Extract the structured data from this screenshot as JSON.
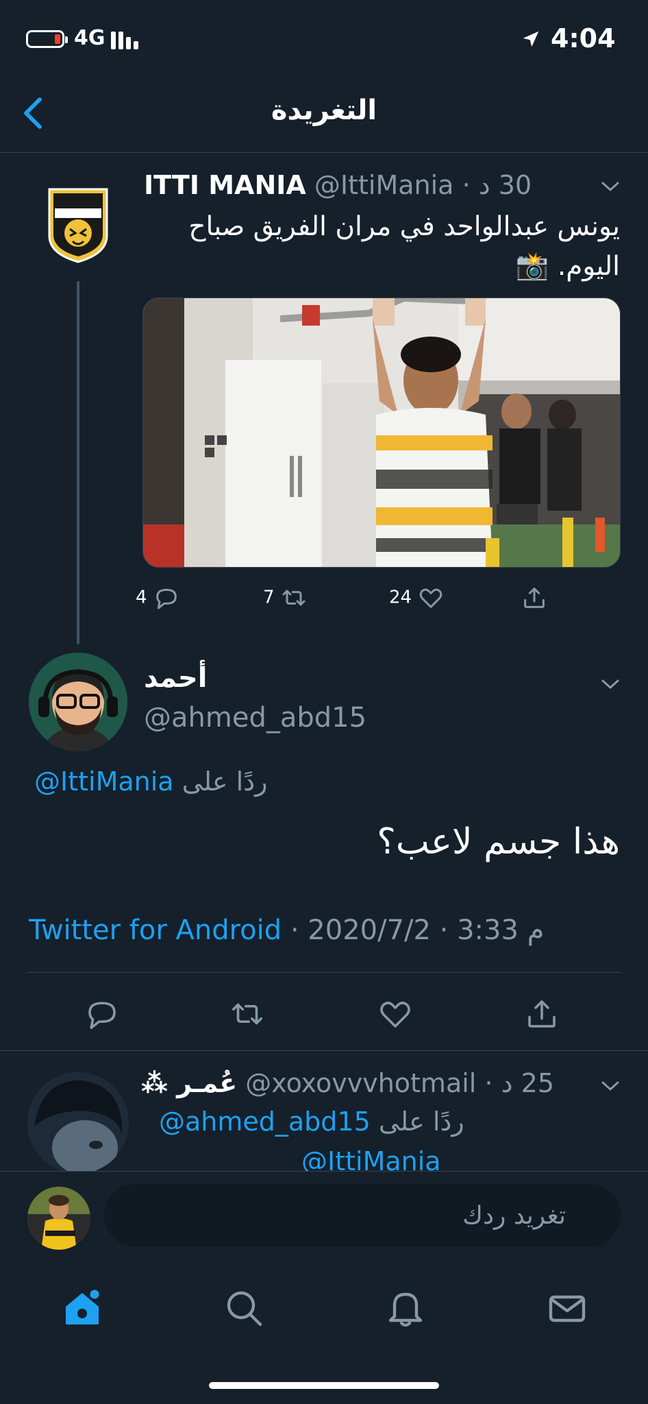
{
  "status_bar": {
    "network": "4G",
    "time": "4:04"
  },
  "header": {
    "title": "التغريدة"
  },
  "parent_tweet": {
    "name": "ITTI MANIA",
    "handle": "@IttiMania",
    "separator": "·",
    "time": "30 د",
    "text": "يونس عبدالواحد في مران الفريق صباح اليوم. 📸",
    "counts": {
      "replies": "4",
      "retweets": "7",
      "likes": "24"
    }
  },
  "main_tweet": {
    "name": "أحمد",
    "handle": "@ahmed_abd15",
    "reply_to_label": "ردًا على",
    "reply_to_handle": "@IttiMania",
    "text": "هذا جسم لاعب؟",
    "source": "Twitter for Android",
    "separator": "·",
    "date": "2020/7/2",
    "time": "3:33 م"
  },
  "reply_tweet": {
    "name": "عُمـر ⁂",
    "handle": "@xoxovvvhotmail",
    "separator": "·",
    "time": "25 د",
    "reply_to_label": "ردًا على",
    "reply_to_handle": "@ahmed_abd15",
    "reply_to_handle_2": "@IttiMania"
  },
  "composer": {
    "placeholder": "تغريد ردك"
  },
  "colors": {
    "background": "#15202b",
    "accent": "#1da1f2",
    "muted": "#8899a6",
    "divider": "#38444d"
  }
}
